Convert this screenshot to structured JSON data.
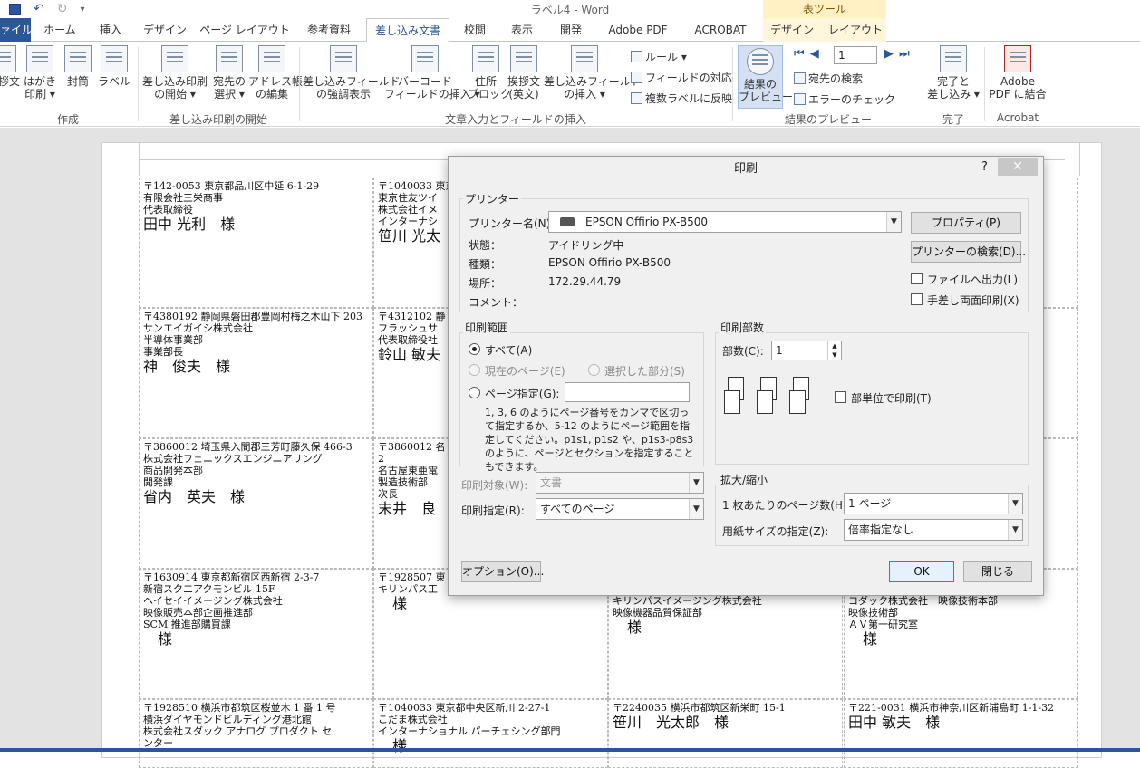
{
  "window": {
    "title": "ラベル4 - Word",
    "context_group": "表ツール"
  },
  "tabs": [
    "ァイル",
    "ホーム",
    "挿入",
    "デザイン",
    "ページ レイアウト",
    "参考資料",
    "差し込み文書",
    "校閲",
    "表示",
    "開発",
    "Adobe PDF",
    "ACROBAT",
    "デザイン",
    "レイアウト"
  ],
  "ribbon": {
    "create": {
      "label": "作成",
      "buttons": [
        "挨拶文",
        "はがき\n印刷 ▾",
        "封筒",
        "ラベル"
      ]
    },
    "start": {
      "label": "差し込み印刷の開始",
      "buttons": [
        "差し込み印刷\nの開始 ▾",
        "宛先の\n選択 ▾",
        "アドレス帳\nの編集"
      ]
    },
    "fields": {
      "label": "文章入力とフィールドの挿入",
      "buttons": [
        "差し込みフィールド\nの強調表示",
        "バーコード\nフィールドの挿入 ▾",
        "住所\nブロック",
        "挨拶文\n(英文)",
        "差し込みフィールド\nの挿入 ▾"
      ],
      "small": [
        "ルール ▾",
        "フィールドの対応",
        "複数ラベルに反映"
      ]
    },
    "preview": {
      "label": "結果のプレビュー",
      "button": "結果の\nプレビュー",
      "record": "1",
      "small": [
        "宛先の検索",
        "エラーのチェック"
      ]
    },
    "finish": {
      "label": "完了",
      "button": "完了と\n差し込み ▾"
    },
    "acrobat": {
      "label": "Acrobat",
      "button": "Adobe\nPDF に結合"
    }
  },
  "labels": [
    "〒142-0053 東京都品川区中延 6-1-29\n有限会社三栄商事\n代表取締役\n|田中 光利　様",
    "〒1040033 東京都中\n東京住友ツイ\n株式会社イメ\nインターナシ\n|笹川 光太",
    "",
    "",
    "〒4380192 静岡県磐田郡豊岡村梅之木山下 203\nサンエイガイシ株式会社\n半導体事業部\n事業部長\n|神　俊夫　様",
    "〒4312102 静\nフラッシュサ\n代表取締役社\n|鈴山 敏夫",
    "",
    "",
    "〒3860012 埼玉県入間郡三芳町藤久保 466-3\n株式会社フェニックスエンジニアリング\n商品開発本部\n開発課\n|省内　英夫　様",
    "〒3860012 名\n2\n名古屋東亜電\n製造技術部\n次長\n|末井　良",
    "",
    "",
    "〒1630914 東京都新宿区西新宿 2-3-7\n新宿スクエアクモンビル 15F\nヘイセイイメージング株式会社\n映像販売本部企画推進部\nSCM 推進部購買課\n|　様",
    "〒1928507 東\nキリンパス工\n|　様",
    "\n\nキリンパスイメージング株式会社\n映像機器品質保証部\n|　様",
    "\n\nコダック株式会社　映像技術本部\n映像技術部\nＡＶ第一研究室\n|　様",
    "〒1928510 横浜市都筑区桜並木 1 番 1 号\n横浜ダイヤモンドビルディング港北館\n株式会社スダック アナログ プロダクト セ\nンター",
    "〒1040033 東京都中央区新川 2-27-1\nこだま株式会社\nインターナショナル パーチェシング部門\n|　様",
    "〒2240035 横浜市都筑区新栄町 15-1\n|笹川　光太郎　様",
    "〒221-0031 横浜市神奈川区新浦島町 1-1-32\n|田中 敏夫　様"
  ],
  "dialog": {
    "title": "印刷",
    "help": "?",
    "close": "✕",
    "printer": {
      "group": "プリンター",
      "name_label": "プリンター名(N):",
      "name_value": "EPSON Offirio PX-B500",
      "status_label": "状態：",
      "status_value": "アイドリング中",
      "type_label": "種類：",
      "type_value": "EPSON Offirio PX-B500",
      "where_label": "場所：",
      "where_value": "172.29.44.79",
      "comment_label": "コメント：",
      "properties": "プロパティ(P)",
      "find": "プリンターの検索(D)...",
      "print_to_file": "ファイルへ出力(L)",
      "manual_duplex": "手差し両面印刷(X)"
    },
    "range": {
      "group": "印刷範囲",
      "all": "すべて(A)",
      "current": "現在のページ(E)",
      "selection": "選択した部分(S)",
      "pages": "ページ指定(G):",
      "help": "1, 3, 6 のようにページ番号をカンマで区切って指定するか、5-12 のようにページ範囲を指定してください。p1s1, p1s2 や、p1s3-p8s3 のように、ページとセクションを指定することもできます。"
    },
    "print_what_label": "印刷対象(W):",
    "print_what_value": "文書",
    "print_label": "印刷指定(R):",
    "print_value": "すべてのページ",
    "copies": {
      "group": "印刷部数",
      "label": "部数(C):",
      "value": "1",
      "collate": "部単位で印刷(T)"
    },
    "zoom": {
      "group": "拡大/縮小",
      "pages_label": "1 枚あたりのページ数(H):",
      "pages_value": "1 ページ",
      "scale_label": "用紙サイズの指定(Z):",
      "scale_value": "倍率指定なし"
    },
    "options": "オプション(O)...",
    "ok": "OK",
    "cancel": "閉じる"
  }
}
